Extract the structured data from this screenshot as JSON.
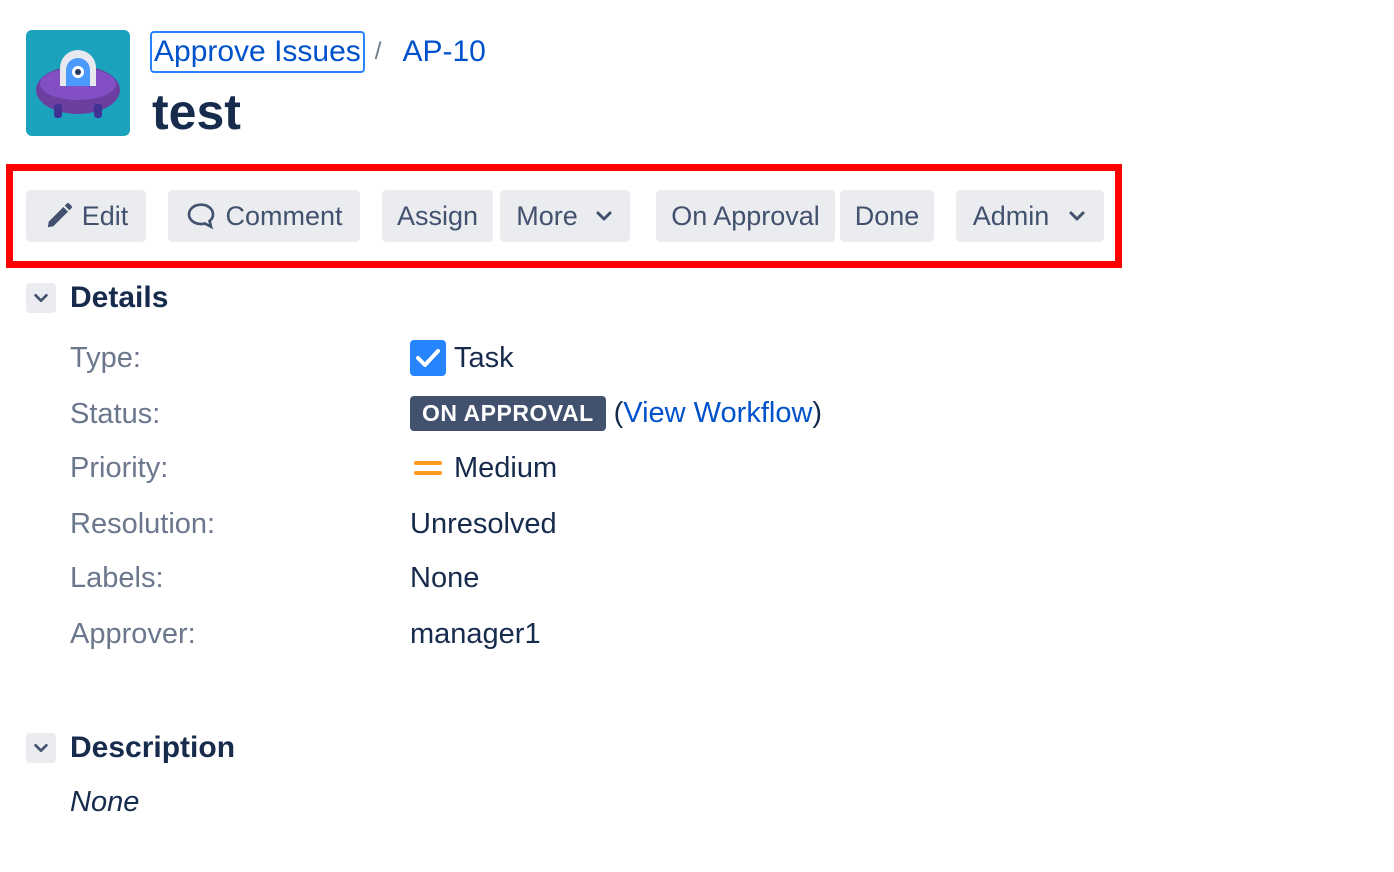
{
  "breadcrumb": {
    "project": "Approve Issues",
    "separator": "/",
    "issue_key": "AP-10"
  },
  "issue": {
    "title": "test"
  },
  "toolbar": {
    "edit": "Edit",
    "comment": "Comment",
    "assign": "Assign",
    "more": "More",
    "on_approval": "On Approval",
    "done": "Done",
    "admin": "Admin"
  },
  "details": {
    "heading": "Details",
    "type_label": "Type:",
    "type_value": "Task",
    "status_label": "Status:",
    "status_value": "ON APPROVAL",
    "workflow_open": "(",
    "workflow_link": "View Workflow",
    "workflow_close": ")",
    "priority_label": "Priority:",
    "priority_value": "Medium",
    "resolution_label": "Resolution:",
    "resolution_value": "Unresolved",
    "labels_label": "Labels:",
    "labels_value": "None",
    "approver_label": "Approver:",
    "approver_value": "manager1"
  },
  "description": {
    "heading": "Description",
    "value": "None"
  },
  "colors": {
    "link": "#0052cc",
    "highlight": "#ff0000",
    "lozenge": "#42526e",
    "priority_medium": "#ff991f",
    "task_icon": "#2684ff"
  },
  "icons": {
    "project_avatar": "ufo-avatar-icon",
    "edit": "pencil-icon",
    "comment": "speech-bubble-icon",
    "dropdown": "chevron-down-icon",
    "section_toggle": "chevron-down-icon",
    "type": "task-checkbox-icon",
    "priority": "priority-medium-icon"
  }
}
